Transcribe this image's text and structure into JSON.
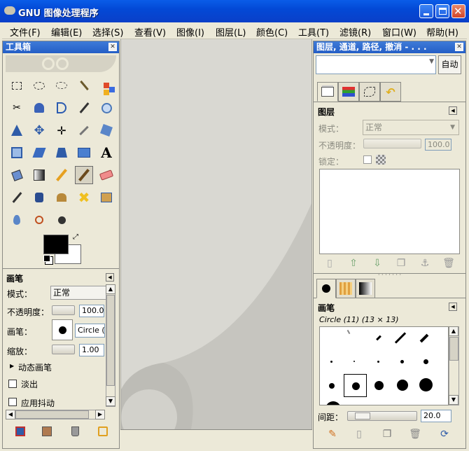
{
  "window": {
    "title": "GNU 图像处理程序"
  },
  "menu": [
    "文件(F)",
    "编辑(E)",
    "选择(S)",
    "查看(V)",
    "图像(I)",
    "图层(L)",
    "颜色(C)",
    "工具(T)",
    "滤镜(R)",
    "窗口(W)",
    "帮助(H)"
  ],
  "toolbox": {
    "title": "工具箱",
    "tools": [
      "rect-select",
      "ellipse-select",
      "free-select",
      "fuzzy-select",
      "color-select",
      "scissors",
      "foreground-select",
      "paths",
      "color-picker",
      "zoom",
      "measure",
      "move",
      "align",
      "crop",
      "rotate",
      "scale",
      "shear",
      "perspective",
      "flip",
      "text",
      "bucket-fill",
      "blend",
      "pencil",
      "paintbrush",
      "eraser",
      "airbrush",
      "ink",
      "clone",
      "heal",
      "perspective-clone",
      "smudge",
      "blur",
      "dodge-burn"
    ],
    "active_tool": "paintbrush",
    "fg_color": "#000000",
    "bg_color": "#ffffff"
  },
  "tool_options": {
    "title": "画笔",
    "mode_label": "模式：",
    "mode_value": "正常",
    "opacity_label": "不透明度：",
    "opacity_value": "100.0",
    "brush_label": "画笔：",
    "brush_value": "Circle (1",
    "scale_label": "缩放：",
    "scale_value": "1.00",
    "dynamics_label": "动态画笔",
    "fade_label": "淡出",
    "jitter_label": "应用抖动"
  },
  "layers_dock": {
    "title": "图层, 通道, 路径, 撤消 - . . .",
    "auto_label": "自动",
    "section_title": "图层",
    "mode_label": "模式：",
    "mode_value": "正常",
    "opacity_label": "不透明度：",
    "opacity_value": "100.0",
    "lock_label": "锁定："
  },
  "brushes_dock": {
    "section_title": "画笔",
    "brush_name": "Circle (11) (13 × 13)",
    "spacing_label": "间距：",
    "spacing_value": "20.0"
  }
}
